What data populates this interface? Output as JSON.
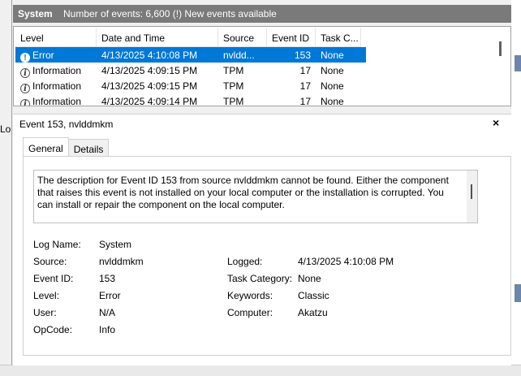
{
  "header": {
    "title": "System",
    "info": "Number of events: 6,600 (!) New events available"
  },
  "columns": [
    "Level",
    "Date and Time",
    "Source",
    "Event ID",
    "Task C..."
  ],
  "rows": [
    {
      "level": "Error",
      "icon": "error-icon",
      "date": "4/13/2025 4:10:08 PM",
      "source": "nvldd...",
      "event_id": "153",
      "task": "None"
    },
    {
      "level": "Information",
      "icon": "info-icon",
      "date": "4/13/2025 4:09:15 PM",
      "source": "TPM",
      "event_id": "17",
      "task": "None"
    },
    {
      "level": "Information",
      "icon": "info-icon",
      "date": "4/13/2025 4:09:15 PM",
      "source": "TPM",
      "event_id": "17",
      "task": "None"
    },
    {
      "level": "Information",
      "icon": "info-icon",
      "date": "4/13/2025 4:09:14 PM",
      "source": "TPM",
      "event_id": "17",
      "task": "None"
    }
  ],
  "left_label": "Lo",
  "detail": {
    "title": "Event 153, nvlddmkm",
    "close": "×",
    "tabs": [
      "General",
      "Details"
    ],
    "description": "The description for Event ID 153 from source nvlddmkm cannot be found. Either the component that raises this event is not installed on your local computer or the installation is corrupted. You can install or repair the component on the local computer.",
    "fields": {
      "log_name_label": "Log Name:",
      "log_name": "System",
      "source_label": "Source:",
      "source": "nvlddmkm",
      "event_id_label": "Event ID:",
      "event_id": "153",
      "level_label": "Level:",
      "level": "Error",
      "user_label": "User:",
      "user": "N/A",
      "opcode_label": "OpCode:",
      "opcode": "Info",
      "logged_label": "Logged:",
      "logged": "4/13/2025 4:10:08 PM",
      "task_category_label": "Task Category:",
      "task_category": "None",
      "keywords_label": "Keywords:",
      "keywords": "Classic",
      "computer_label": "Computer:",
      "computer": "Akatzu"
    }
  },
  "colors": {
    "selection": "#0078d7",
    "header_bg": "#7a7a7a"
  }
}
